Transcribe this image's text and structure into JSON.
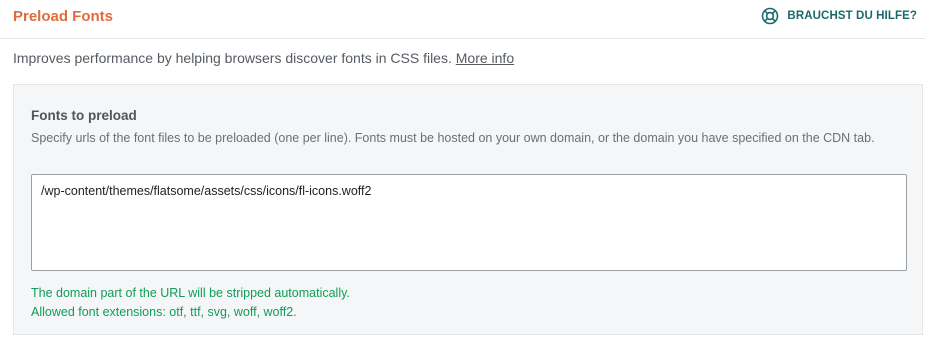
{
  "section": {
    "title": "Preload Fonts",
    "help_label": "BRAUCHST DU HILFE?",
    "description": "Improves performance by helping browsers discover fonts in CSS files.",
    "more_info_link": "More info"
  },
  "field": {
    "label": "Fonts to preload",
    "hint": "Specify urls of the font files to be preloaded (one per line). Fonts must be hosted on your own domain, or the domain you have specified on the CDN tab.",
    "value": "/wp-content/themes/flatsome/assets/css/icons/fl-icons.woff2",
    "note_domain": "The domain part of the URL will be stripped automatically.",
    "note_extensions": "Allowed font extensions: otf, ttf, svg, woff, woff2."
  },
  "colors": {
    "title": "#e26b3e",
    "help": "#1a6a6d",
    "note": "#0f9d58"
  },
  "icons": {
    "help": "lifebuoy-icon"
  }
}
